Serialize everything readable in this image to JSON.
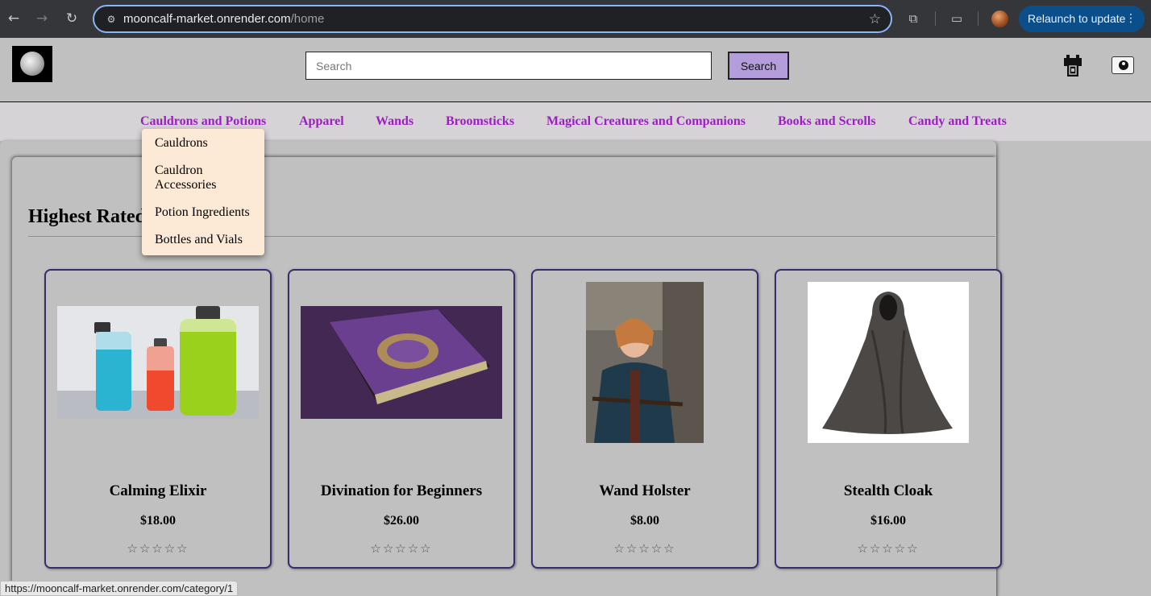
{
  "browser": {
    "url_host": "mooncalf-market.onrender.com",
    "url_path": "/home",
    "relaunch_label": "Relaunch to update",
    "status_url": "https://mooncalf-market.onrender.com/category/1"
  },
  "header": {
    "search_placeholder": "Search",
    "search_button": "Search"
  },
  "categories": [
    "Cauldrons and Potions",
    "Apparel",
    "Wands",
    "Broomsticks",
    "Magical Creatures and Companions",
    "Books and Scrolls",
    "Candy and Treats"
  ],
  "dropdown": {
    "items": [
      "Cauldrons",
      "Cauldron Accessories",
      "Potion Ingredients",
      "Bottles and Vials"
    ]
  },
  "section": {
    "title": "Highest Rated"
  },
  "products": [
    {
      "name": "Calming Elixir",
      "price": "$18.00",
      "stars": "☆☆☆☆☆",
      "rating": 0
    },
    {
      "name": "Divination for Beginners",
      "price": "$26.00",
      "stars": "☆☆☆☆☆",
      "rating": 0
    },
    {
      "name": "Wand Holster",
      "price": "$8.00",
      "stars": "☆☆☆☆☆",
      "rating": 0
    },
    {
      "name": "Stealth Cloak",
      "price": "$16.00",
      "stars": "☆☆☆☆☆",
      "rating": 0
    }
  ],
  "colors": {
    "category_link": "#9b1fbf",
    "search_button_bg": "#b39ddb",
    "card_border": "#3b2a6e",
    "dropdown_bg": "#fce9d6",
    "relaunch_bg": "#0b4f8a"
  }
}
